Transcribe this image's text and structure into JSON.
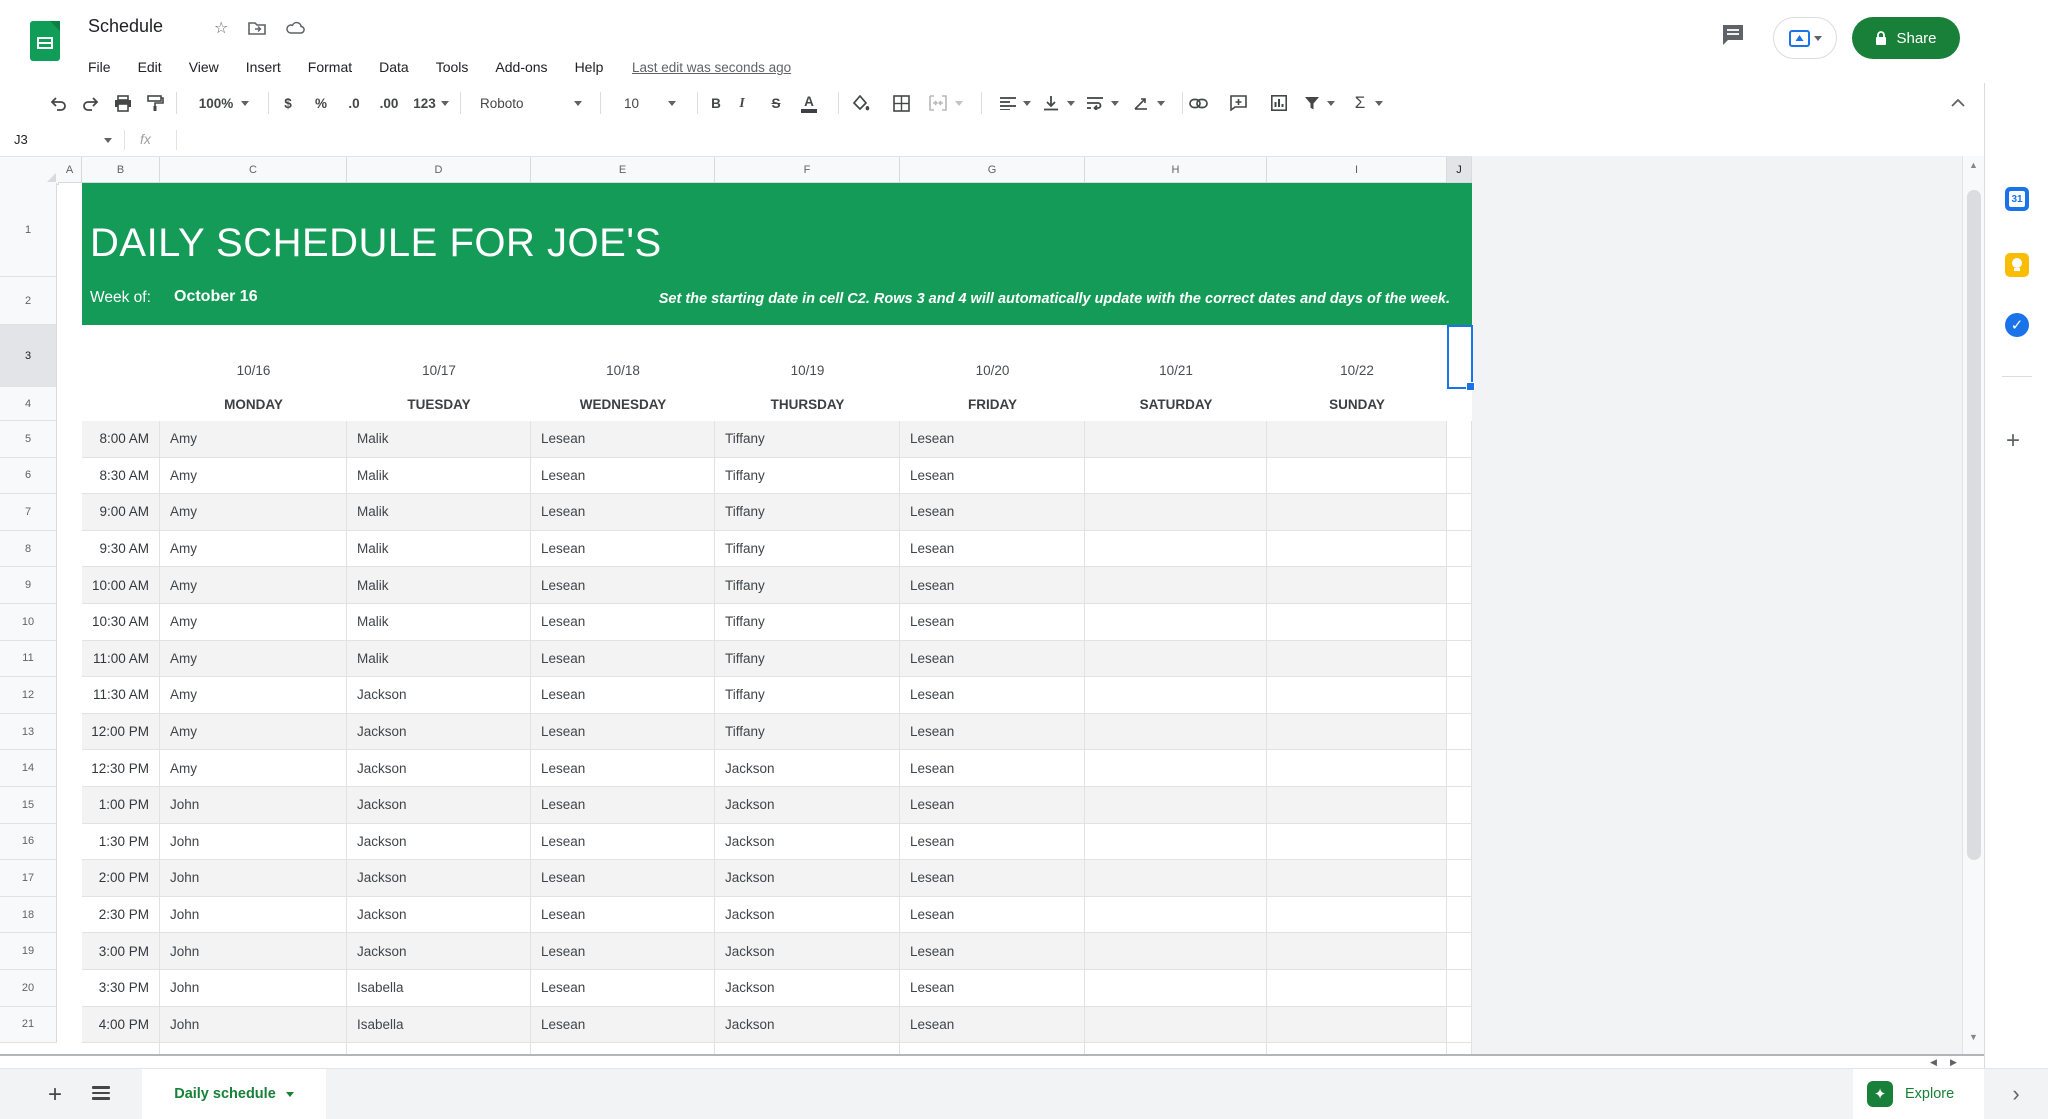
{
  "header": {
    "doc_title": "Schedule",
    "menu_items": [
      "File",
      "Edit",
      "View",
      "Insert",
      "Format",
      "Data",
      "Tools",
      "Add-ons",
      "Help"
    ],
    "last_edit": "Last edit was seconds ago",
    "share_label": "Share"
  },
  "toolbar": {
    "zoom": "100%",
    "currency": "$",
    "percent": "%",
    "decrease_decimal": ".0",
    "increase_decimal": ".00",
    "more_formats": "123",
    "font_name": "Roboto",
    "font_size": "10",
    "bold": "B",
    "italic": "I",
    "strikethrough": "S",
    "text_color": "A",
    "functions": "Σ"
  },
  "formula_bar": {
    "cell_reference": "J3",
    "fx_label": "fx"
  },
  "grid": {
    "column_letters": [
      "A",
      "B",
      "C",
      "D",
      "E",
      "F",
      "G",
      "H",
      "I",
      "J"
    ],
    "row_numbers": [
      "1",
      "2",
      "3",
      "4",
      "5",
      "6",
      "7",
      "8",
      "9",
      "10",
      "11",
      "12",
      "13",
      "14",
      "15",
      "16",
      "17",
      "18",
      "19",
      "20",
      "21"
    ],
    "selected_cell": "J3"
  },
  "banner": {
    "title": "DAILY SCHEDULE FOR JOE'S",
    "week_of_label": "Week of:",
    "week_start_date": "October 16",
    "note": "Set the starting date in cell C2. Rows 3 and 4 will automatically update with the correct dates and days of the week."
  },
  "schedule": {
    "dates": [
      "10/16",
      "10/17",
      "10/18",
      "10/19",
      "10/20",
      "10/21",
      "10/22"
    ],
    "days": [
      "MONDAY",
      "TUESDAY",
      "WEDNESDAY",
      "THURSDAY",
      "FRIDAY",
      "SATURDAY",
      "SUNDAY"
    ],
    "rows": [
      {
        "time": "8:00 AM",
        "cells": [
          "Amy",
          "Malik",
          "Lesean",
          "Tiffany",
          "Lesean",
          "",
          ""
        ]
      },
      {
        "time": "8:30 AM",
        "cells": [
          "Amy",
          "Malik",
          "Lesean",
          "Tiffany",
          "Lesean",
          "",
          ""
        ]
      },
      {
        "time": "9:00 AM",
        "cells": [
          "Amy",
          "Malik",
          "Lesean",
          "Tiffany",
          "Lesean",
          "",
          ""
        ]
      },
      {
        "time": "9:30 AM",
        "cells": [
          "Amy",
          "Malik",
          "Lesean",
          "Tiffany",
          "Lesean",
          "",
          ""
        ]
      },
      {
        "time": "10:00 AM",
        "cells": [
          "Amy",
          "Malik",
          "Lesean",
          "Tiffany",
          "Lesean",
          "",
          ""
        ]
      },
      {
        "time": "10:30 AM",
        "cells": [
          "Amy",
          "Malik",
          "Lesean",
          "Tiffany",
          "Lesean",
          "",
          ""
        ]
      },
      {
        "time": "11:00 AM",
        "cells": [
          "Amy",
          "Malik",
          "Lesean",
          "Tiffany",
          "Lesean",
          "",
          ""
        ]
      },
      {
        "time": "11:30 AM",
        "cells": [
          "Amy",
          "Jackson",
          "Lesean",
          "Tiffany",
          "Lesean",
          "",
          ""
        ]
      },
      {
        "time": "12:00 PM",
        "cells": [
          "Amy",
          "Jackson",
          "Lesean",
          "Tiffany",
          "Lesean",
          "",
          ""
        ]
      },
      {
        "time": "12:30 PM",
        "cells": [
          "Amy",
          "Jackson",
          "Lesean",
          "Jackson",
          "Lesean",
          "",
          ""
        ]
      },
      {
        "time": "1:00 PM",
        "cells": [
          "John",
          "Jackson",
          "Lesean",
          "Jackson",
          "Lesean",
          "",
          ""
        ]
      },
      {
        "time": "1:30 PM",
        "cells": [
          "John",
          "Jackson",
          "Lesean",
          "Jackson",
          "Lesean",
          "",
          ""
        ]
      },
      {
        "time": "2:00 PM",
        "cells": [
          "John",
          "Jackson",
          "Lesean",
          "Jackson",
          "Lesean",
          "",
          ""
        ]
      },
      {
        "time": "2:30 PM",
        "cells": [
          "John",
          "Jackson",
          "Lesean",
          "Jackson",
          "Lesean",
          "",
          ""
        ]
      },
      {
        "time": "3:00 PM",
        "cells": [
          "John",
          "Jackson",
          "Lesean",
          "Jackson",
          "Lesean",
          "",
          ""
        ]
      },
      {
        "time": "3:30 PM",
        "cells": [
          "John",
          "Isabella",
          "Lesean",
          "Jackson",
          "Lesean",
          "",
          ""
        ]
      },
      {
        "time": "4:00 PM",
        "cells": [
          "John",
          "Isabella",
          "Lesean",
          "Jackson",
          "Lesean",
          "",
          ""
        ]
      }
    ]
  },
  "tabbar": {
    "active_tab": "Daily schedule",
    "explore_label": "Explore"
  },
  "side_panel": {
    "calendar_label": "31"
  },
  "colors": {
    "banner_green": "#149b57",
    "share_green": "#188038",
    "accent_blue": "#1a73e8"
  }
}
